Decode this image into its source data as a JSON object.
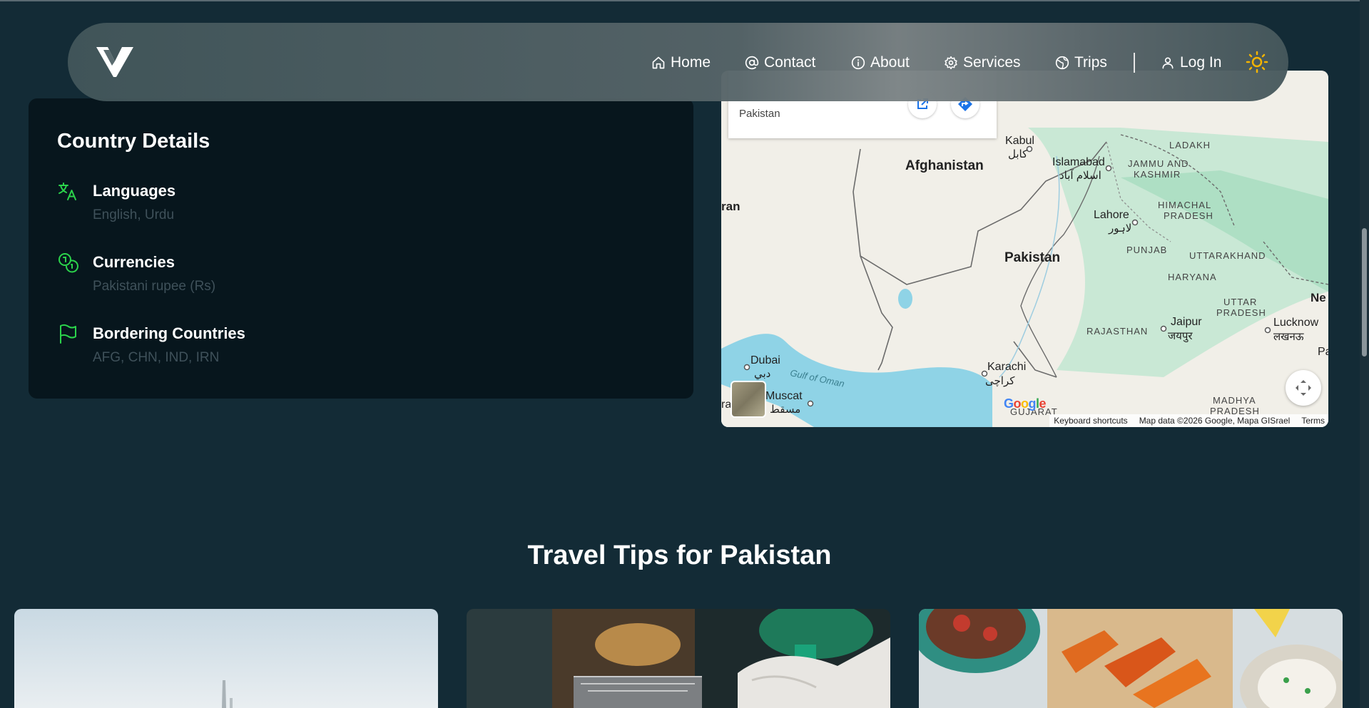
{
  "nav": {
    "logo_alt": "V logo",
    "items": [
      {
        "label": "Home",
        "icon": "home-icon"
      },
      {
        "label": "Contact",
        "icon": "at-icon"
      },
      {
        "label": "About",
        "icon": "info-icon"
      },
      {
        "label": "Services",
        "icon": "gear-icon"
      },
      {
        "label": "Trips",
        "icon": "globe-icon"
      }
    ],
    "login": {
      "label": "Log In",
      "icon": "user-icon"
    },
    "theme_toggle_icon": "sun-icon"
  },
  "country_details": {
    "title": "Country Details",
    "rows": [
      {
        "label": "Languages",
        "value": "English, Urdu",
        "icon": "translate-icon"
      },
      {
        "label": "Currencies",
        "value": "Pakistani rupee (Rs)",
        "icon": "coins-icon"
      },
      {
        "label": "Bordering Countries",
        "value": "AFG, CHN, IND, IRN",
        "icon": "flag-icon"
      }
    ]
  },
  "map": {
    "infobox_place": "Pakistan",
    "labels": {
      "afghanistan": "Afghanistan",
      "pakistan": "Pakistan",
      "kabul": "Kabul",
      "kabul_local": "کابل",
      "islamabad": "Islamabad",
      "islamabad_local": "اسلام آباد",
      "lahore": "Lahore",
      "lahore_local": "لاہور",
      "karachi": "Karachi",
      "karachi_local": "کراچی",
      "dubai": "Dubai",
      "dubai_local": "دبي",
      "muscat": "Muscat",
      "muscat_local": "مسقط",
      "iran_partial": "ran",
      "ra_partial": "ra",
      "jammu": "JAMMU AND",
      "kashmir": "KASHMIR",
      "ladakh": "LADAKH",
      "himachal": "HIMACHAL",
      "himachal2": "PRADESH",
      "punjab": "PUNJAB",
      "uttarakhand": "UTTARAKHAND",
      "haryana": "HARYANA",
      "uttar": "UTTAR",
      "uttar2": "PRADESH",
      "rajasthan": "RAJASTHAN",
      "jaipur": "Jaipur",
      "jaipur_local": "जयपुर",
      "lucknow": "Lucknow",
      "lucknow_local": "लखनऊ",
      "madhya": "MADHYA",
      "madhya2": "PRADESH",
      "gujarat": "GUJARAT",
      "gulf": "Gulf of Oman",
      "ne_partial": "Ne",
      "pa_partial": "Pa"
    },
    "google": "Google",
    "footer": {
      "shortcuts": "Keyboard shortcuts",
      "data": "Map data ©2026 Google, Mapa GISrael",
      "terms": "Terms"
    }
  },
  "tips": {
    "title": "Travel Tips for Pakistan"
  },
  "colors": {
    "background": "#132b36",
    "card": "#07161d",
    "accent_green": "#2bd34b",
    "sun": "#f5b400"
  }
}
